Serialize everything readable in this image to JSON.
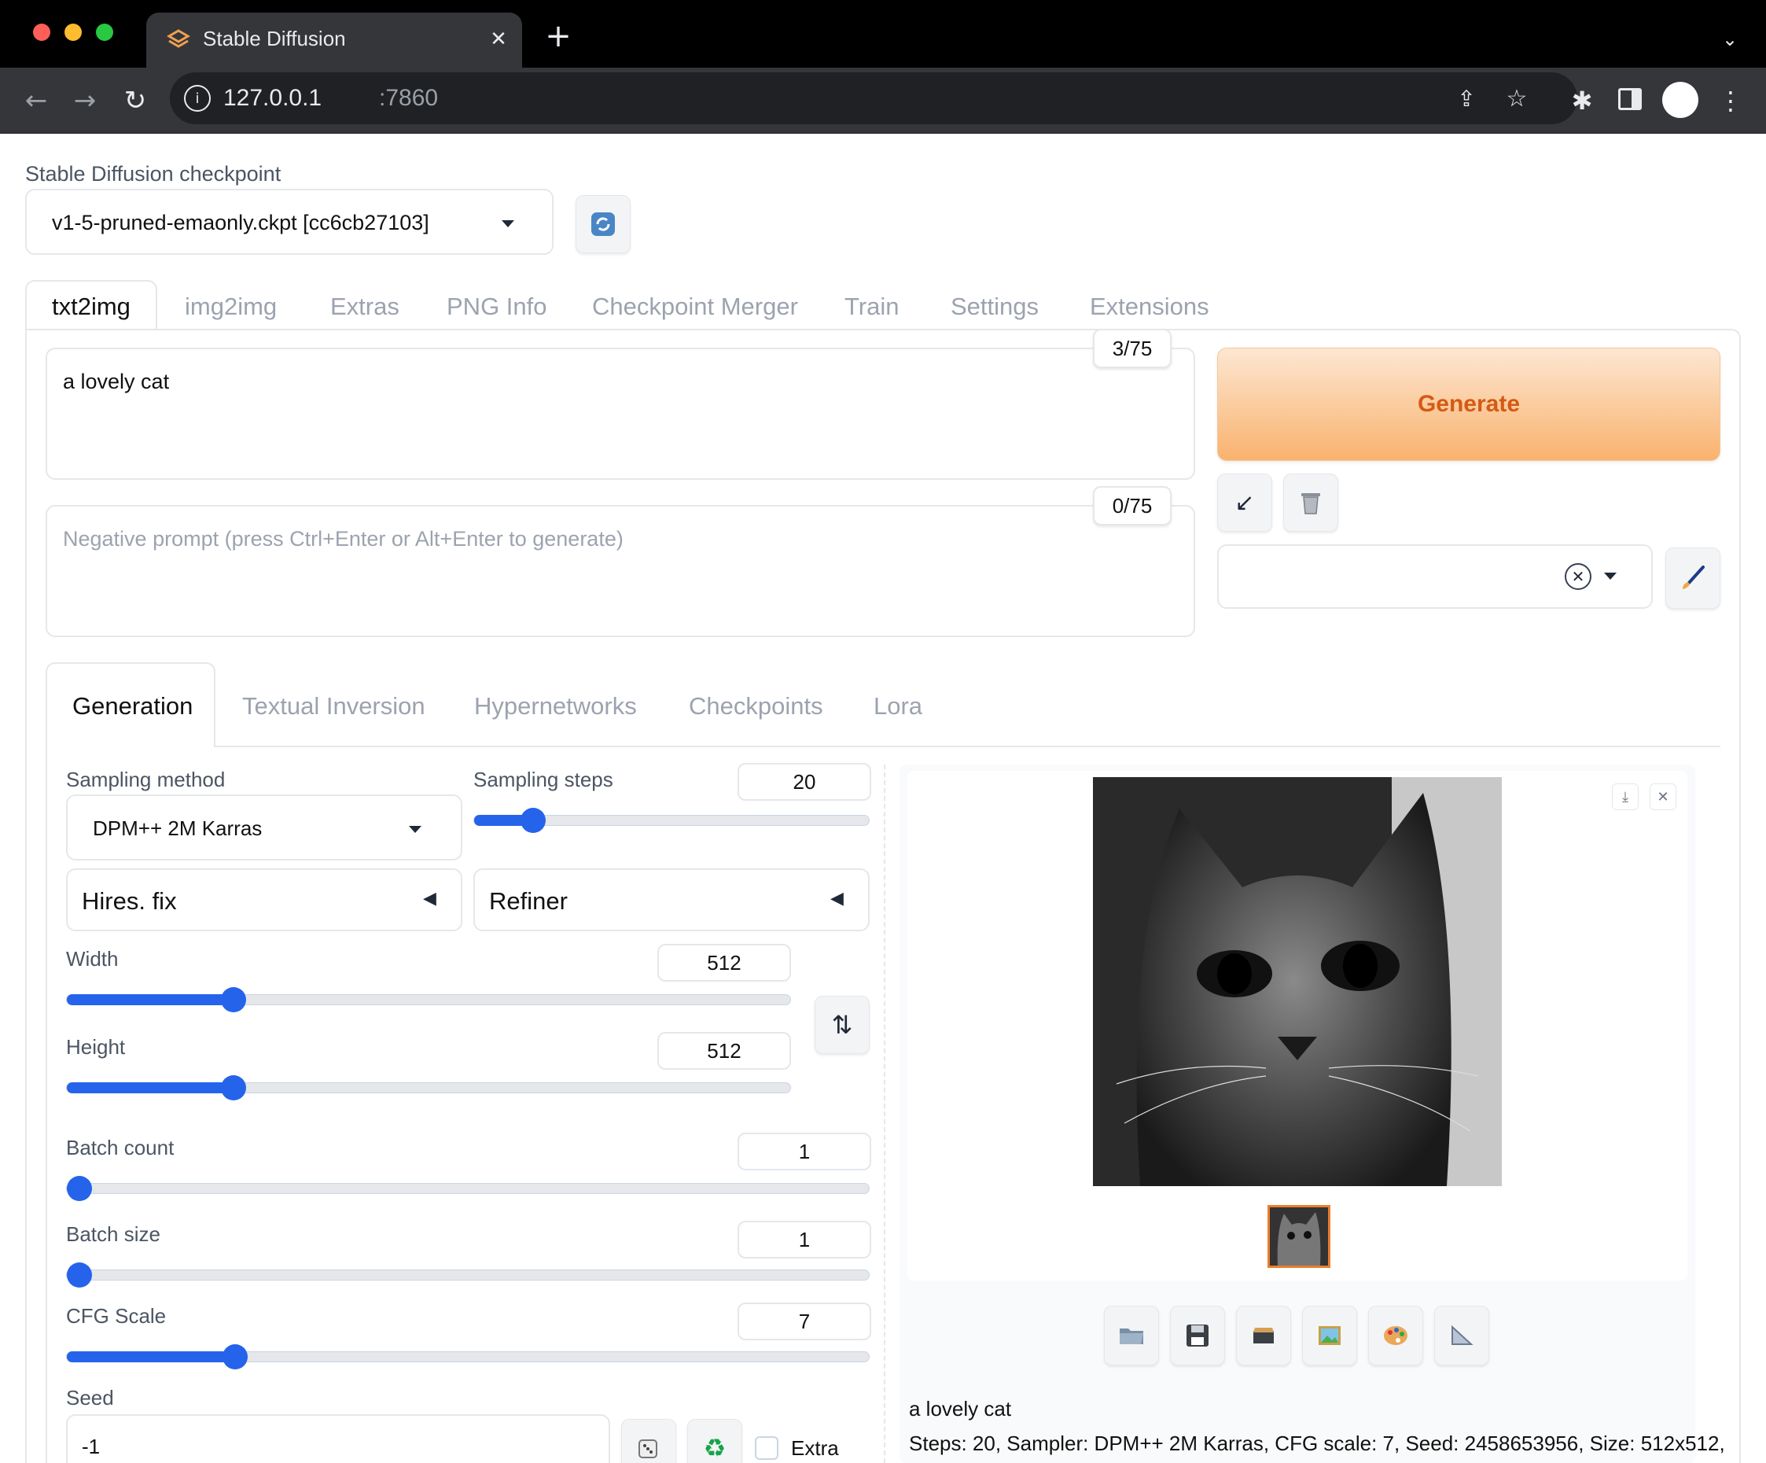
{
  "browser": {
    "tab_title": "Stable Diffusion",
    "url_host": "127.0.0.1",
    "url_port": ":7860",
    "new_tab": "+"
  },
  "checkpoint": {
    "label": "Stable Diffusion checkpoint",
    "value": "v1-5-pruned-emaonly.ckpt [cc6cb27103]"
  },
  "main_tabs": [
    "txt2img",
    "img2img",
    "Extras",
    "PNG Info",
    "Checkpoint Merger",
    "Train",
    "Settings",
    "Extensions"
  ],
  "prompt": {
    "value": "a lovely cat",
    "token_count": "3/75",
    "negative_placeholder": "Negative prompt (press Ctrl+Enter or Alt+Enter to generate)",
    "negative_token_count": "0/75"
  },
  "generate_label": "Generate",
  "sub_tabs": [
    "Generation",
    "Textual Inversion",
    "Hypernetworks",
    "Checkpoints",
    "Lora"
  ],
  "params": {
    "sampling_method_label": "Sampling method",
    "sampling_method": "DPM++ 2M Karras",
    "sampling_steps_label": "Sampling steps",
    "sampling_steps": "20",
    "sampling_steps_fraction": 0.15,
    "hires_label": "Hires. fix",
    "refiner_label": "Refiner",
    "width_label": "Width",
    "width": "512",
    "width_fraction": 0.23,
    "height_label": "Height",
    "height": "512",
    "height_fraction": 0.23,
    "batch_count_label": "Batch count",
    "batch_count": "1",
    "batch_count_fraction": 0.0,
    "batch_size_label": "Batch size",
    "batch_size": "1",
    "batch_size_fraction": 0.0,
    "cfg_label": "CFG Scale",
    "cfg": "7",
    "cfg_fraction": 0.21,
    "seed_label": "Seed",
    "seed": "-1",
    "extra_label": "Extra"
  },
  "output": {
    "caption": "a lovely cat",
    "info": "Steps: 20, Sampler: DPM++ 2M Karras, CFG scale: 7, Seed: 2458653956, Size: 512x512,"
  },
  "colors": {
    "accent": "#2563eb",
    "generate_from": "#fde7d2",
    "generate_to": "#f9b26e",
    "generate_text": "#d45a13",
    "thumb_border": "#e97d2f"
  }
}
